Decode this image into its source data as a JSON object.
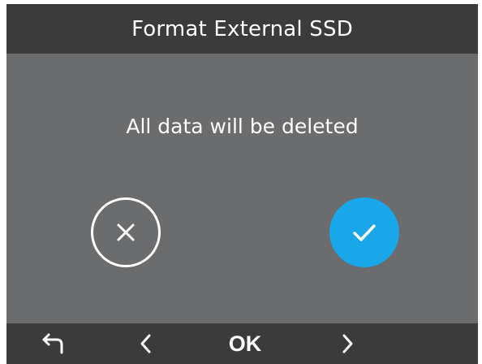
{
  "dialog": {
    "title": "Format External SSD",
    "message": "All data will be deleted"
  },
  "buttons": {
    "cancel_icon": "close-icon",
    "confirm_icon": "checkmark-icon"
  },
  "bottom_bar": {
    "back_icon": "back-arrow-icon",
    "prev_icon": "chevron-left-icon",
    "ok_label": "OK",
    "next_icon": "chevron-right-icon"
  },
  "colors": {
    "header_background": "#3b3b3c",
    "dialog_background": "#6b6c6e",
    "confirm_accent": "#19a7ea",
    "text": "#ffffff"
  }
}
